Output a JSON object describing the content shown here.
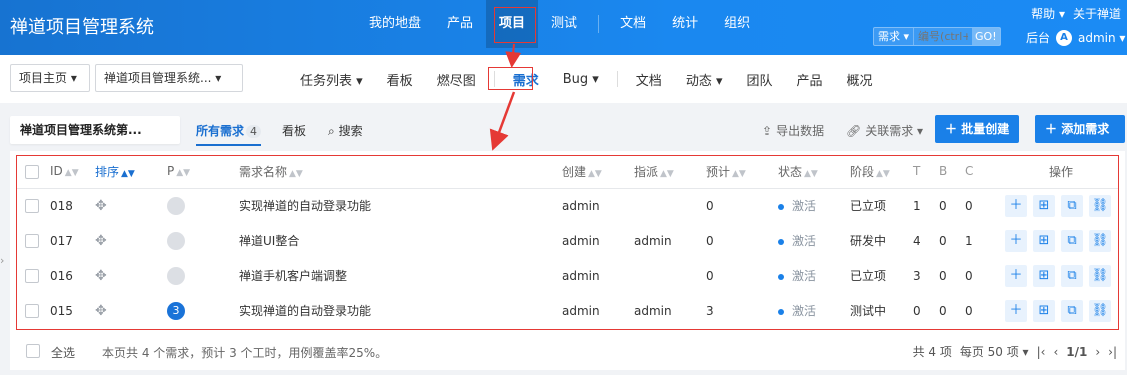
{
  "app": {
    "title": "禅道项目管理系统"
  },
  "main_nav": [
    {
      "label": "我的地盘"
    },
    {
      "label": "产品"
    },
    {
      "label": "项目"
    },
    {
      "label": "测试"
    },
    {
      "label": "文档"
    },
    {
      "label": "统计"
    },
    {
      "label": "组织"
    }
  ],
  "top_links": {
    "help": "帮助 ▾",
    "about": "关于禅道"
  },
  "search": {
    "type": "需求 ▾",
    "placeholder": "编号(ctrl+g)",
    "go": "GO!"
  },
  "backend": "后台",
  "user": {
    "avatar": "A",
    "name": "admin ▾"
  },
  "breadcrumbs": {
    "home": "项目主页 ▾",
    "project": "禅道项目管理系统... ▾"
  },
  "sub_nav": [
    {
      "label": "任务列表 ▾"
    },
    {
      "label": "看板"
    },
    {
      "label": "燃尽图"
    },
    {
      "label": "需求"
    },
    {
      "label": "Bug ▾"
    },
    {
      "label": "文档"
    },
    {
      "label": "动态 ▾"
    },
    {
      "label": "团队"
    },
    {
      "label": "产品"
    },
    {
      "label": "概况"
    }
  ],
  "toolbar": {
    "project_title": "禅道项目管理系统第...",
    "tab_all": "所有需求",
    "tab_all_count": "4",
    "tab_kanban": "看板",
    "search_label": "搜索",
    "export": "导出数据",
    "link_story": "关联需求 ▾",
    "batch_create": "批量创建",
    "add_story": "添加需求"
  },
  "table": {
    "headers": [
      "ID",
      "排序",
      "P",
      "需求名称",
      "创建",
      "指派",
      "预计",
      "状态",
      "阶段",
      "T",
      "B",
      "C",
      "操作"
    ],
    "rows": [
      {
        "id": "018",
        "pri": "",
        "name": "实现禅道的自动登录功能",
        "creator": "admin",
        "assigned": "",
        "estimate": "0",
        "status": "激活",
        "stage": "已立项",
        "t": "1",
        "b": "0",
        "c": "0"
      },
      {
        "id": "017",
        "pri": "",
        "name": "禅道UI整合",
        "creator": "admin",
        "assigned": "admin",
        "estimate": "0",
        "status": "激活",
        "stage": "研发中",
        "t": "4",
        "b": "0",
        "c": "1"
      },
      {
        "id": "016",
        "pri": "",
        "name": "禅道手机客户端调整",
        "creator": "admin",
        "assigned": "",
        "estimate": "0",
        "status": "激活",
        "stage": "已立项",
        "t": "3",
        "b": "0",
        "c": "0"
      },
      {
        "id": "015",
        "pri": "3",
        "name": "实现禅道的自动登录功能",
        "creator": "admin",
        "assigned": "admin",
        "estimate": "3",
        "status": "激活",
        "stage": "测试中",
        "t": "0",
        "b": "0",
        "c": "0"
      }
    ]
  },
  "footer": {
    "select_all": "全选",
    "summary": "本页共 4 个需求，预计 3 个工时，用例覆盖率25%。",
    "total": "共 4 项",
    "per_page": "每页 50 项 ▾",
    "page": "1/1"
  },
  "colors": {
    "accent": "#1a80e8",
    "highlight": "#e53935"
  }
}
